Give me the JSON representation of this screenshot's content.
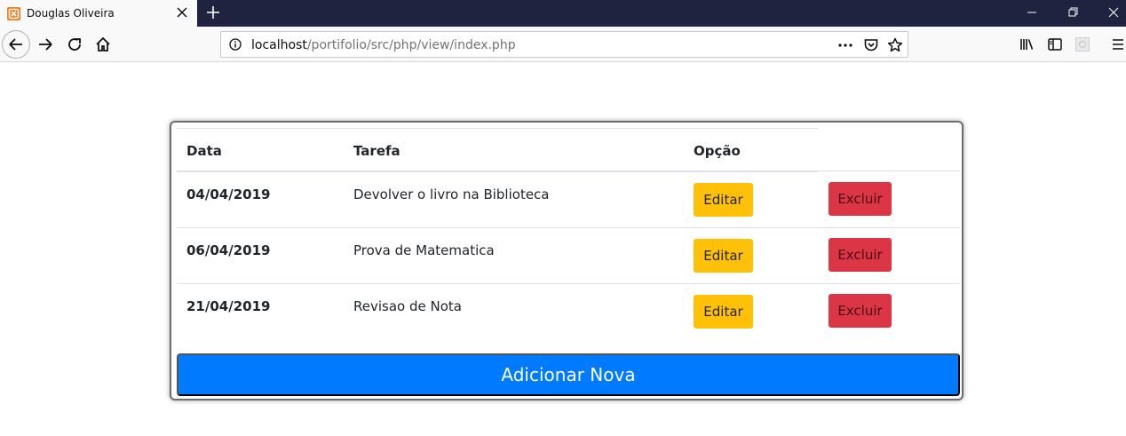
{
  "browser": {
    "tab_title": "Douglas Oliveira",
    "url_host": "localhost",
    "url_path": "/portifolio/src/php/view/index.php"
  },
  "table": {
    "headers": {
      "date": "Data",
      "task": "Tarefa",
      "option": "Opção"
    },
    "rows": [
      {
        "date": "04/04/2019",
        "task": "Devolver o livro na Biblioteca",
        "edit_label": "Editar",
        "delete_label": "Excluir"
      },
      {
        "date": "06/04/2019",
        "task": "Prova de Matematica",
        "edit_label": "Editar",
        "delete_label": "Excluir"
      },
      {
        "date": "21/04/2019",
        "task": "Revisao de Nota",
        "edit_label": "Editar",
        "delete_label": "Excluir"
      }
    ]
  },
  "add_button_label": "Adicionar Nova",
  "colors": {
    "edit_button": "#ffc107",
    "delete_button": "#dc3545",
    "add_button": "#007bff",
    "titlebar": "#202340"
  },
  "icons": {
    "tab": "xampp-favicon-icon",
    "close": "close-icon",
    "new_tab": "plus-icon",
    "back": "back-arrow-icon",
    "forward": "forward-arrow-icon",
    "reload": "reload-icon",
    "home": "home-icon",
    "info": "info-icon",
    "page_actions": "more-horizontal-icon",
    "pocket": "pocket-icon",
    "bookmark": "star-icon",
    "library": "library-icon",
    "sidebar": "sidebar-icon",
    "extension": "extension-icon",
    "menu": "hamburger-menu-icon"
  }
}
